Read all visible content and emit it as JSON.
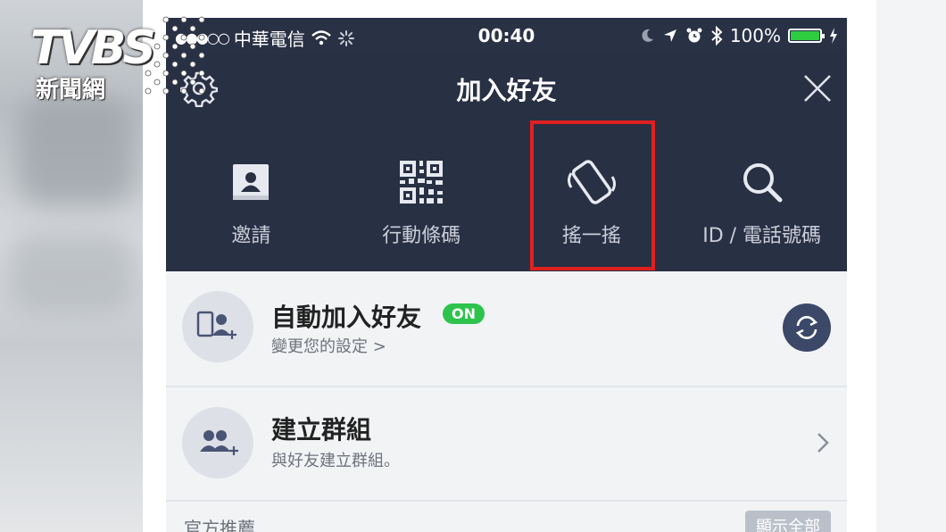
{
  "status_bar": {
    "signal": "●●●○○",
    "carrier": "中華電信",
    "time": "00:40",
    "battery": "100%"
  },
  "header": {
    "title": "加入好友"
  },
  "tabs": [
    {
      "label": "邀請",
      "icon": "contact-card-icon"
    },
    {
      "label": "行動條碼",
      "icon": "qr-code-icon"
    },
    {
      "label": "搖一搖",
      "icon": "shake-phone-icon"
    },
    {
      "label": "ID / 電話號碼",
      "icon": "search-icon"
    }
  ],
  "rows": [
    {
      "title": "自動加入好友",
      "badge": "ON",
      "subtitle": "變更您的設定 >"
    },
    {
      "title": "建立群組",
      "subtitle": "與好友建立群組。"
    }
  ],
  "footer": {
    "label": "官方推薦",
    "show_all": "顯示全部"
  },
  "logo": {
    "brand": "TVBS",
    "subtitle": "新聞網"
  },
  "colors": {
    "nav_bg": "#283044",
    "on_badge": "#2ec34c",
    "highlight": "#e02020",
    "battery": "#2ecc40"
  }
}
